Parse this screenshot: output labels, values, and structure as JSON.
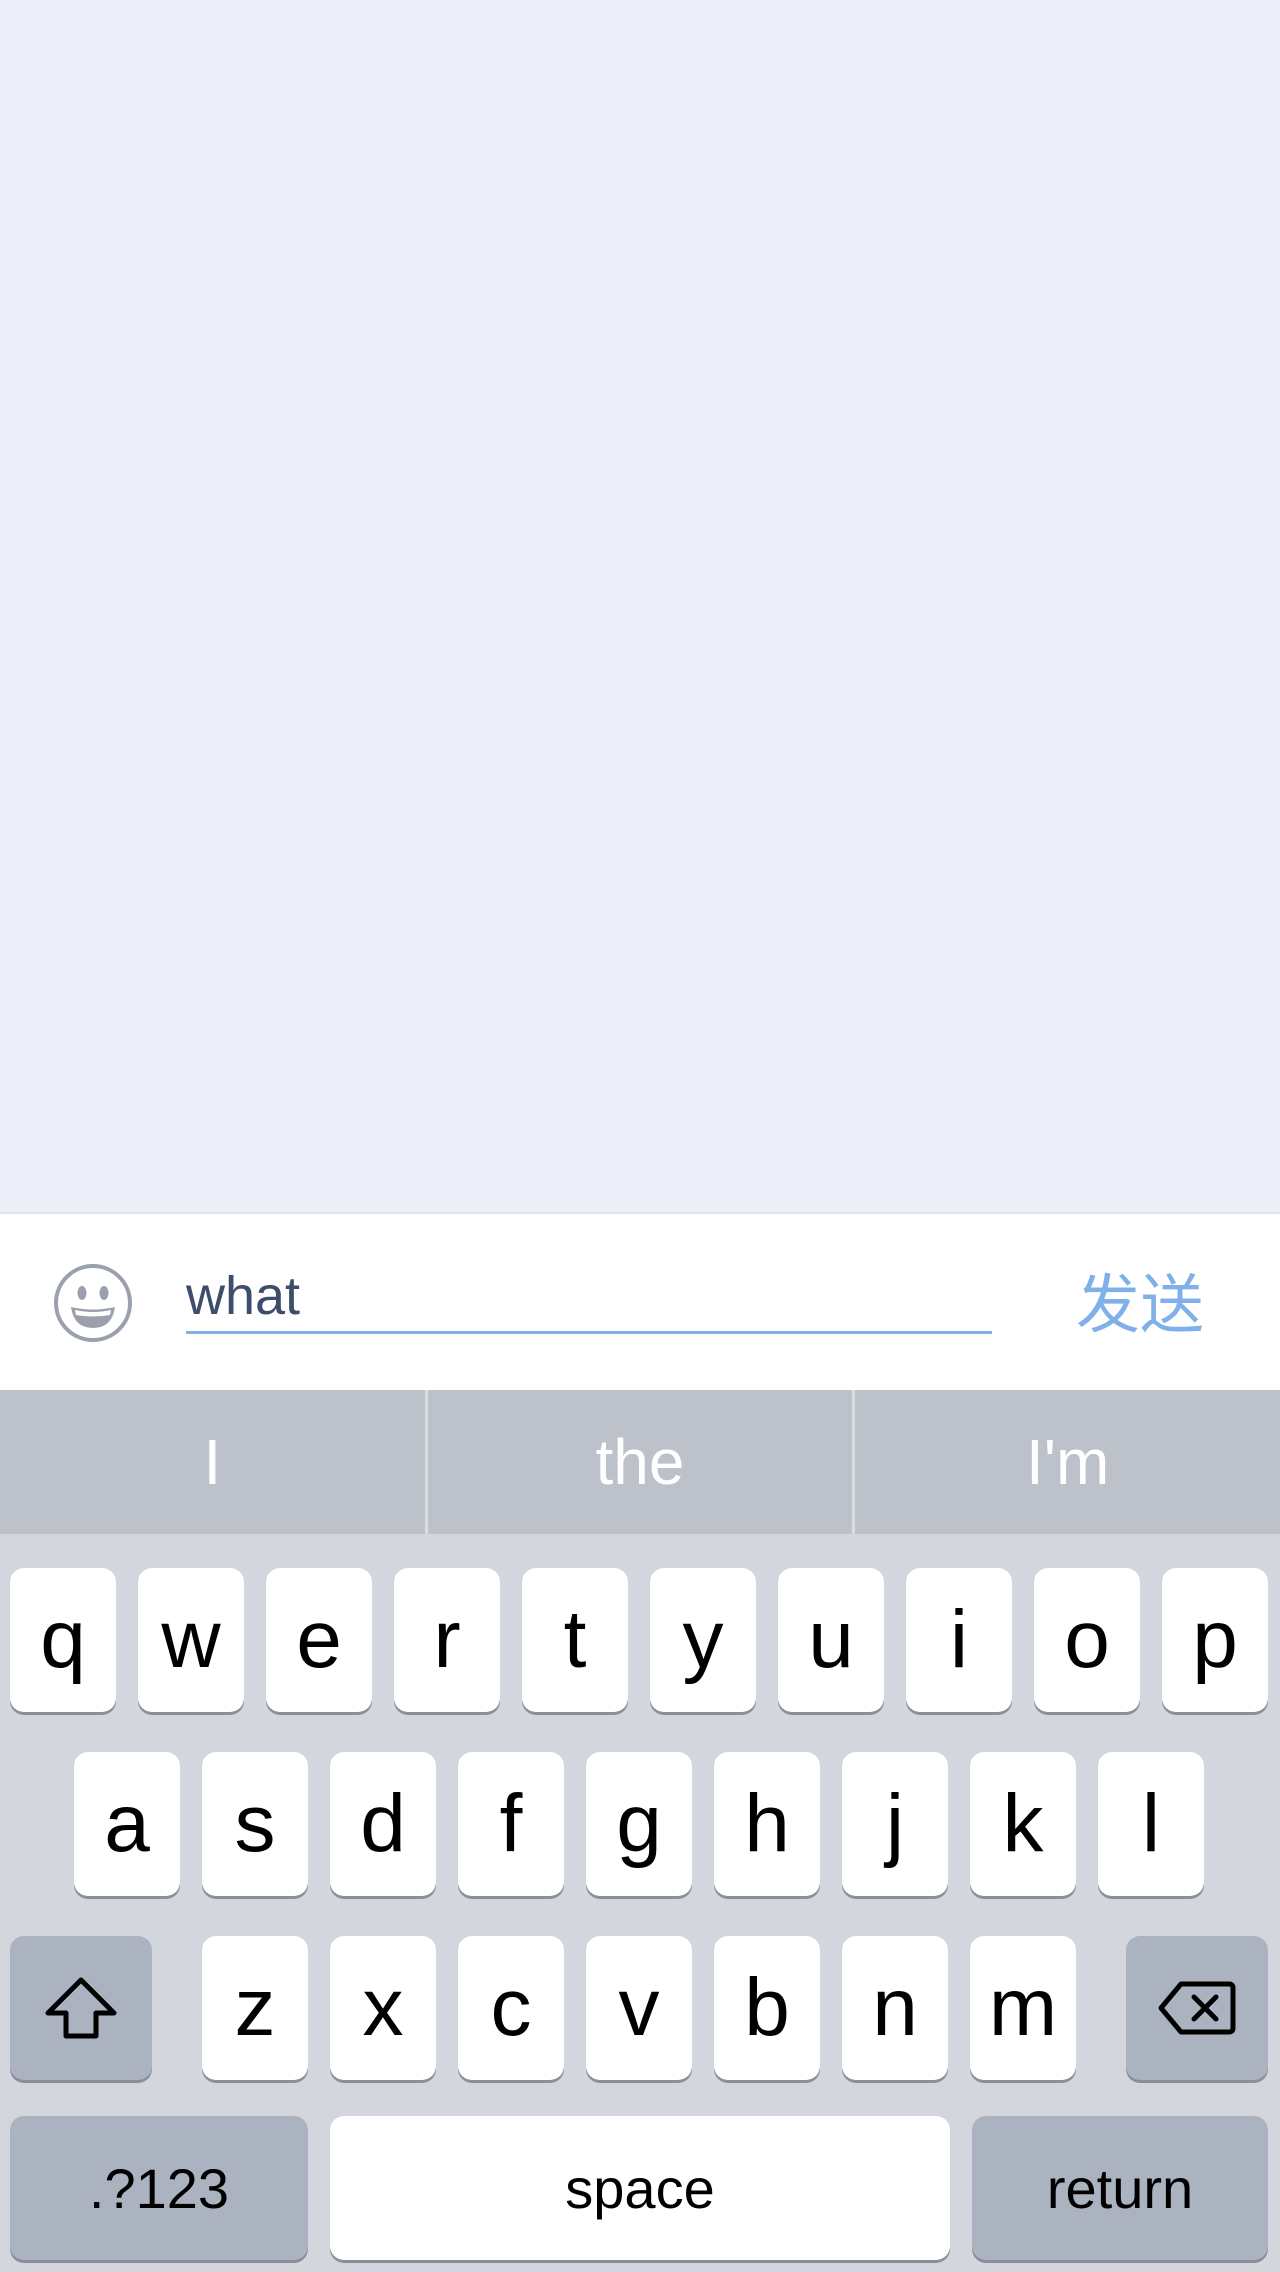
{
  "input": {
    "value": "what",
    "send_label": "发送"
  },
  "suggestions": [
    "I",
    "the",
    "I'm"
  ],
  "keyboard": {
    "row1": [
      "q",
      "w",
      "e",
      "r",
      "t",
      "y",
      "u",
      "i",
      "o",
      "p"
    ],
    "row2": [
      "a",
      "s",
      "d",
      "f",
      "g",
      "h",
      "j",
      "k",
      "l"
    ],
    "row3": [
      "z",
      "x",
      "c",
      "v",
      "b",
      "n",
      "m"
    ],
    "numbers_label": ".?123",
    "space_label": "space",
    "return_label": "return"
  },
  "icons": {
    "emoji": "smiley-face-icon",
    "shift": "shift-arrow-icon",
    "backspace": "backspace-icon"
  },
  "colors": {
    "background": "#eceff7",
    "accent": "#7fb0ea",
    "keyboard": "#d3d6dd",
    "suggestion_bar": "#bcc1ca",
    "dark_key": "#abb3c1"
  }
}
